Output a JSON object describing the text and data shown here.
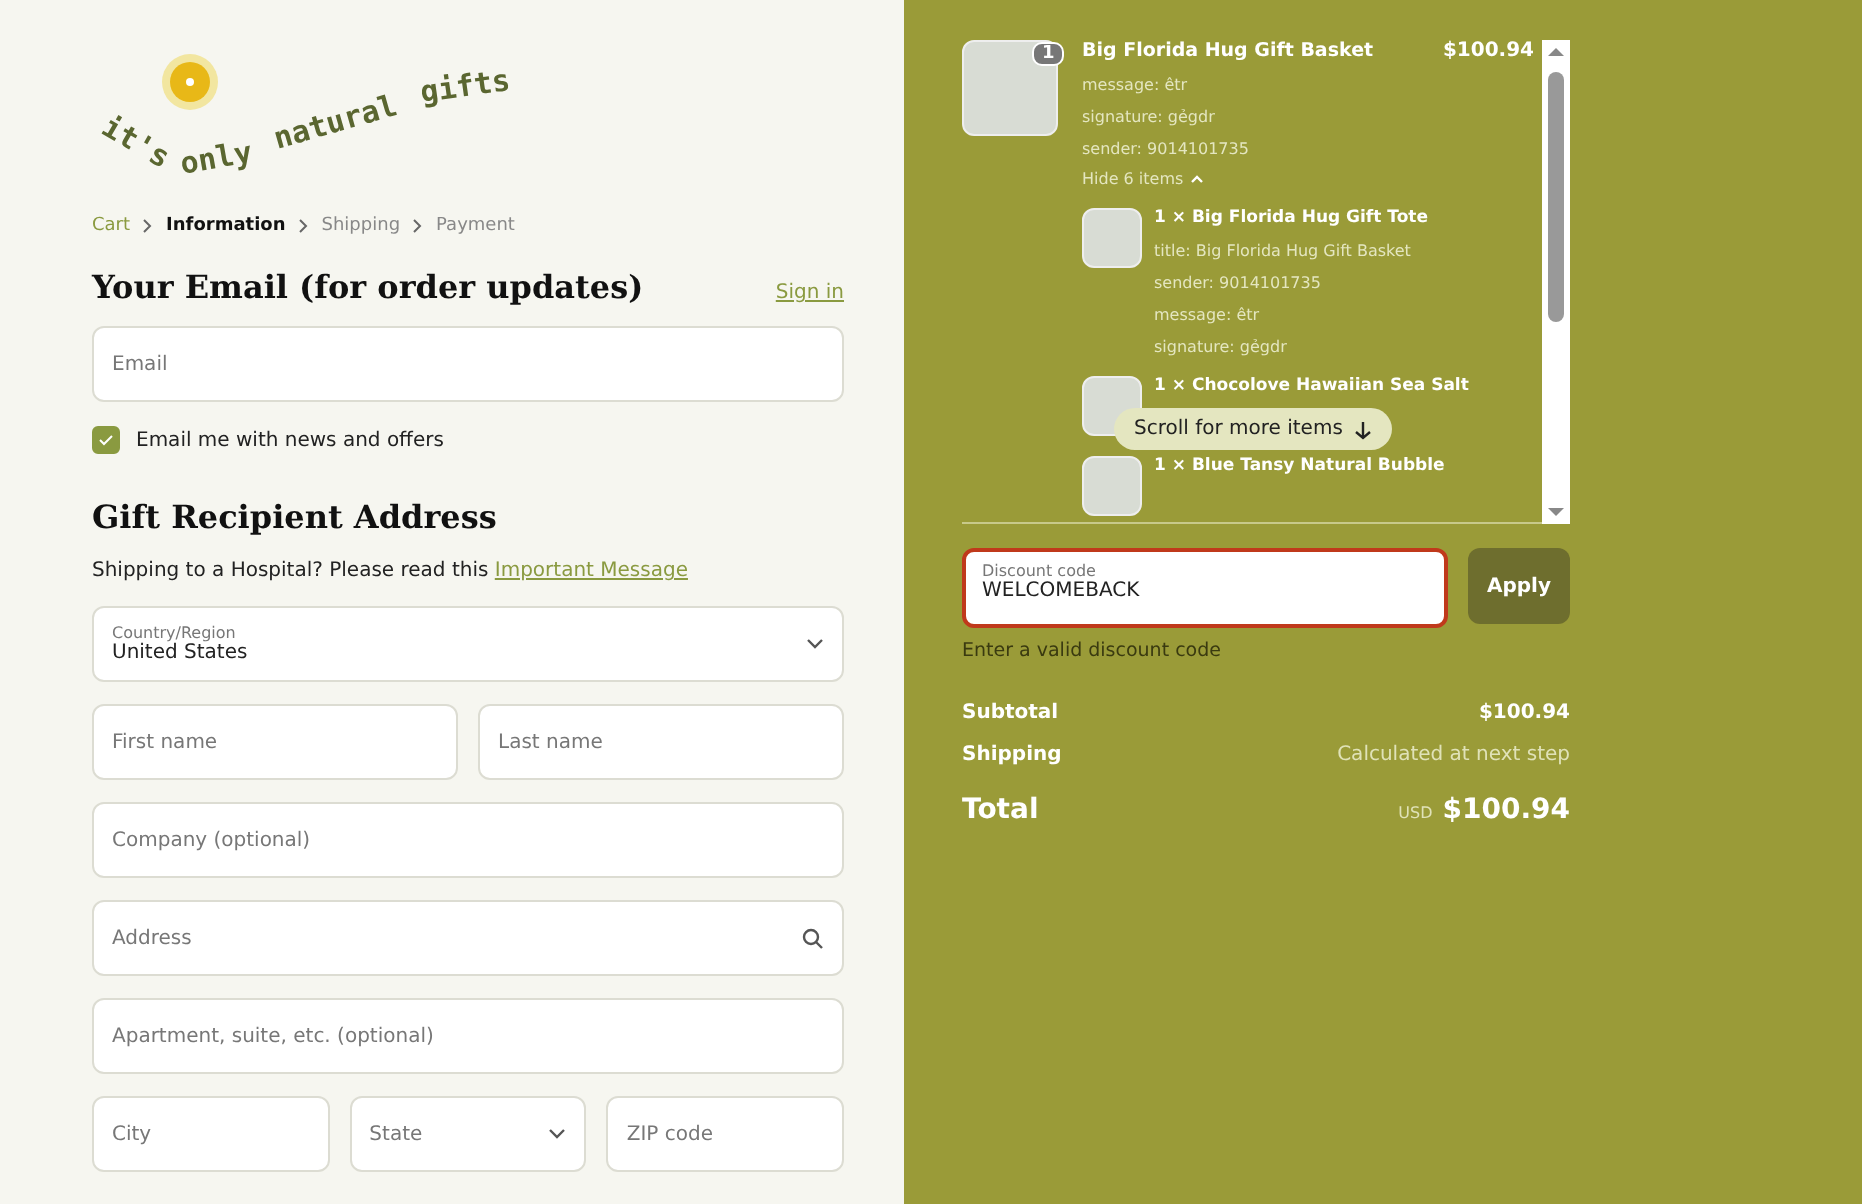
{
  "logo": {
    "words": [
      "it's",
      "only",
      "natural",
      "gifts"
    ]
  },
  "breadcrumbs": [
    {
      "label": "Cart",
      "selected": false,
      "done": true
    },
    {
      "label": "Information",
      "selected": true,
      "done": false
    },
    {
      "label": "Shipping",
      "selected": false,
      "done": false
    },
    {
      "label": "Payment",
      "selected": false,
      "done": false
    }
  ],
  "email_section": {
    "title": "Your Email (for order updates)",
    "sign_in": "Sign in",
    "email": {
      "placeholder": "Email"
    },
    "newsletter": {
      "label": "Email me with news and offers",
      "checked": true
    }
  },
  "address_section": {
    "title": "Gift Recipient Address",
    "note": "Shipping to a Hospital? Please read this",
    "note_link": "Important Message",
    "rows": [
      [
        {
          "kind": "select",
          "label": "Country/Region",
          "value": "United States"
        }
      ],
      [
        {
          "kind": "text",
          "placeholder": "First name"
        },
        {
          "kind": "text",
          "placeholder": "Last name"
        }
      ],
      [
        {
          "kind": "text",
          "placeholder": "Company (optional)"
        }
      ],
      [
        {
          "kind": "search",
          "placeholder": "Address"
        }
      ],
      [
        {
          "kind": "text",
          "placeholder": "Apartment, suite, etc. (optional)"
        }
      ],
      [
        {
          "kind": "text",
          "placeholder": "City"
        },
        {
          "kind": "select",
          "placeholder": "State"
        },
        {
          "kind": "text",
          "placeholder": "ZIP code"
        }
      ]
    ]
  },
  "cart": {
    "item": {
      "quantity": "1",
      "title": "Big Florida Hug Gift Basket",
      "price": "$100.94",
      "properties": [
        "message: êtr",
        "signature: gẻgdr",
        "sender: 9014101735"
      ],
      "toggle": "Hide 6 items",
      "expanded": true,
      "children": [
        {
          "title": "1 × Big Florida Hug Gift Tote",
          "properties": [
            "title: Big Florida Hug Gift Basket",
            "sender: 9014101735",
            "message: êtr",
            "signature: gẻgdr"
          ]
        },
        {
          "title": "1 × Chocolove Hawaiian Sea Salt"
        },
        {
          "title": "1 × Blue Tansy Natural Bubble"
        }
      ]
    },
    "scroll_hint": "Scroll for more items"
  },
  "discount": {
    "label": "Discount code",
    "value": "WELCOMEBACK",
    "error": true,
    "error_message": "Enter a valid discount code",
    "button": "Apply"
  },
  "summary": {
    "rows": [
      {
        "label": "Subtotal",
        "value": "$100.94"
      },
      {
        "label": "Shipping",
        "value": "Calculated at next step"
      }
    ],
    "total_label": "Total",
    "currency": "USD",
    "total": "$100.94"
  }
}
